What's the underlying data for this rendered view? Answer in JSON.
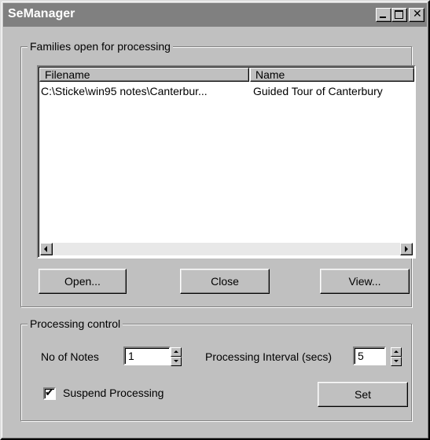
{
  "window": {
    "title": "SeManager",
    "controls": {
      "minimize_icon": "minimize-icon",
      "maximize_icon": "maximize-icon",
      "close_icon": "close-icon",
      "close_glyph": "✕"
    }
  },
  "families_group": {
    "label": "Families open for processing",
    "columns": [
      "Filename",
      "Name"
    ],
    "rows": [
      {
        "filename": "C:\\Sticke\\win95 notes\\Canterbur...",
        "name": "Guided Tour of Canterbury"
      }
    ],
    "buttons": {
      "open": "Open...",
      "close": "Close",
      "view": "View..."
    }
  },
  "processing_group": {
    "label": "Processing control",
    "notes_label": "No of Notes",
    "notes_value": "1",
    "interval_label": "Processing Interval (secs)",
    "interval_value": "5",
    "suspend_label": "Suspend Processing",
    "suspend_checked": true,
    "check_glyph": "✔",
    "set_label": "Set"
  },
  "colors": {
    "face": "#c0c0c0",
    "titlebar_inactive": "#808080",
    "window_bg": "#ffffff"
  }
}
